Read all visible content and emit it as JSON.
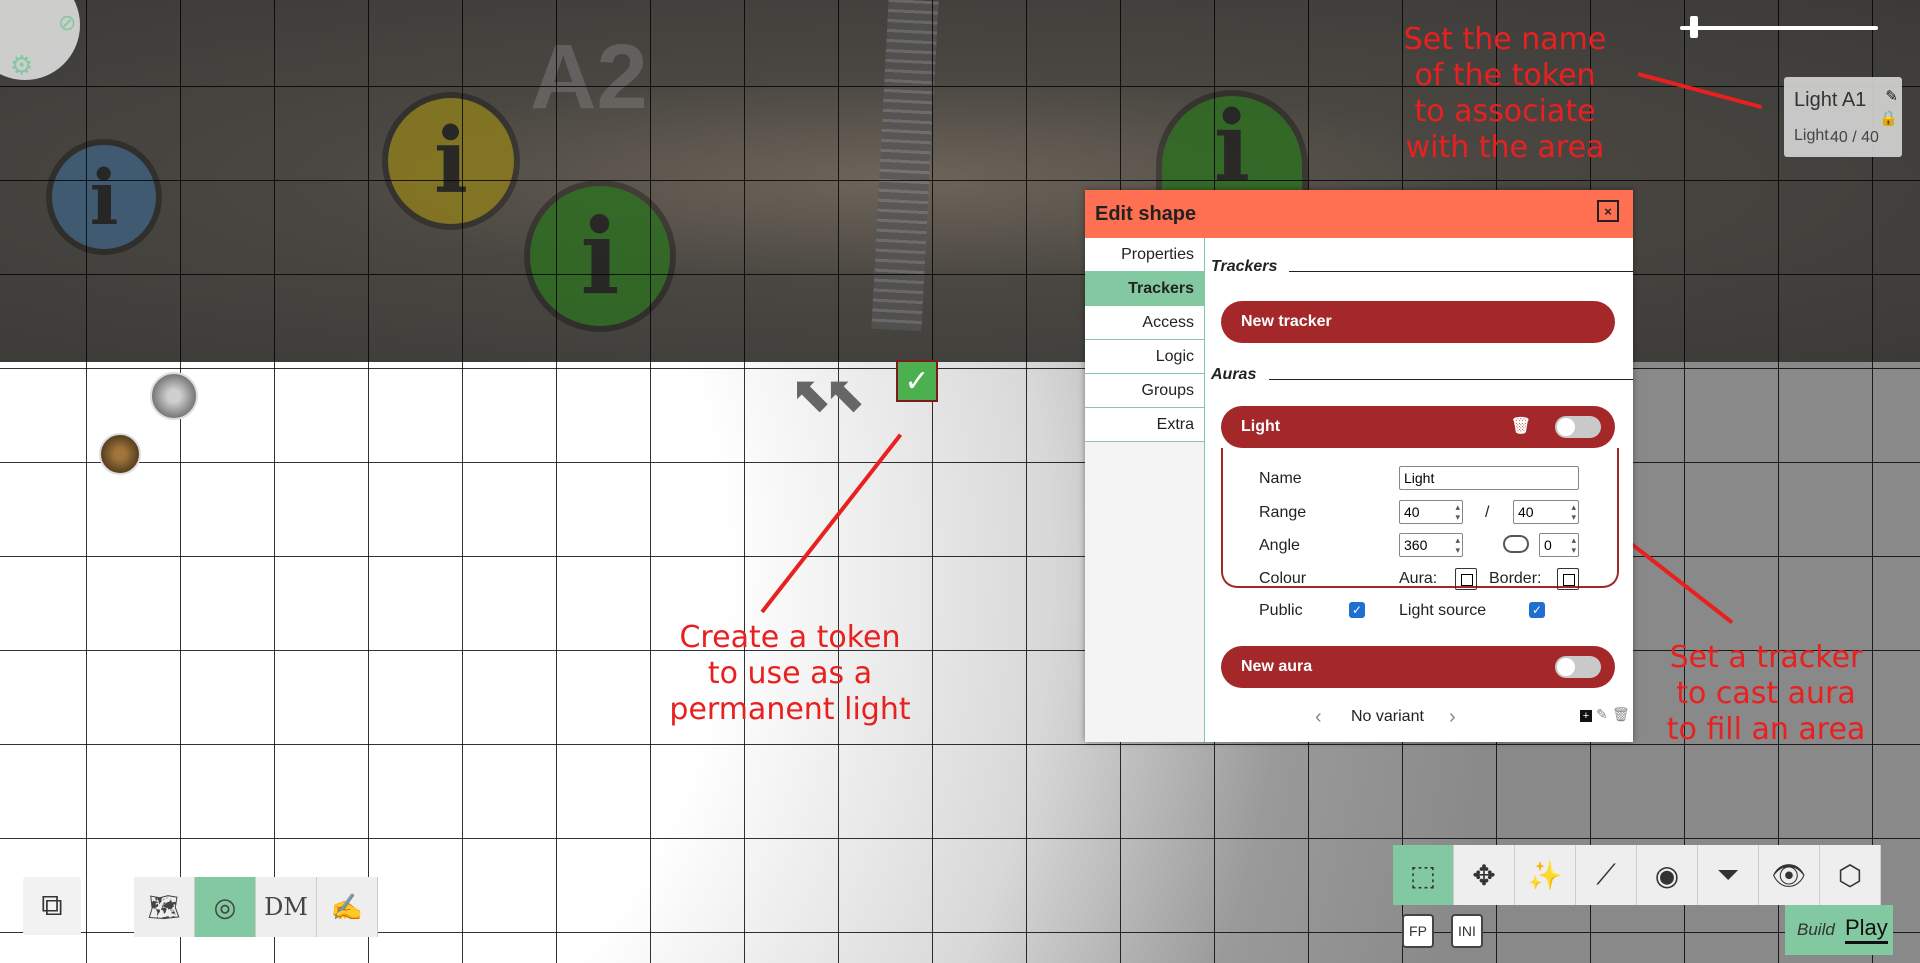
{
  "map": {
    "region_label": "A2",
    "info_marker_glyph": "i"
  },
  "annotations": {
    "token_name": "Set the name\nof the token\nto associate\nwith the area",
    "create_token": "Create a token\nto use as a\npermanent light",
    "tracker": "Set a tracker\nto cast aura\nto fill an area"
  },
  "selection_info": {
    "name": "Light A1",
    "tracker_name": "Light",
    "tracker_value": "40 / 40"
  },
  "dialog": {
    "title": "Edit shape",
    "close_glyph": "×",
    "tabs": [
      {
        "label": "Properties"
      },
      {
        "label": "Trackers"
      },
      {
        "label": "Access"
      },
      {
        "label": "Logic"
      },
      {
        "label": "Groups"
      },
      {
        "label": "Extra"
      }
    ],
    "active_tab": "Trackers",
    "trackers_title": "Trackers",
    "new_tracker_label": "New tracker",
    "auras_title": "Auras",
    "aura": {
      "name_label_header": "Light",
      "name_label": "Name",
      "name_value": "Light",
      "range_label": "Range",
      "range_value": "40",
      "range_sep": "/",
      "range_max": "40",
      "angle_label": "Angle",
      "angle_value": "360",
      "angle_direction": "0",
      "colour_label": "Colour",
      "aura_label": "Aura:",
      "border_label": "Border:",
      "public_label": "Public",
      "public_checked": true,
      "light_source_label": "Light source",
      "light_source_checked": true
    },
    "new_aura_label": "New aura",
    "variant_label": "No variant"
  },
  "zoom": {
    "level": 0.05
  },
  "toolbar_left": {
    "modes": [
      "layers-icon",
      "map-icon",
      "token-icon",
      "dm-icon",
      "draw-icon"
    ],
    "active": "token-icon"
  },
  "toolbar_right": {
    "tools": [
      "select-icon",
      "pan-icon",
      "spell-icon",
      "ruler-icon",
      "ping-icon",
      "filter-icon",
      "vision-icon",
      "dice-icon"
    ],
    "active": "select-icon",
    "fp_label": "FP",
    "ini_label": "INI",
    "build_label": "Build",
    "play_label": "Play"
  },
  "colors": {
    "accent": "#82c8a0",
    "header": "#ff7052",
    "pill": "#a4282a",
    "annotation": "#e82020"
  }
}
